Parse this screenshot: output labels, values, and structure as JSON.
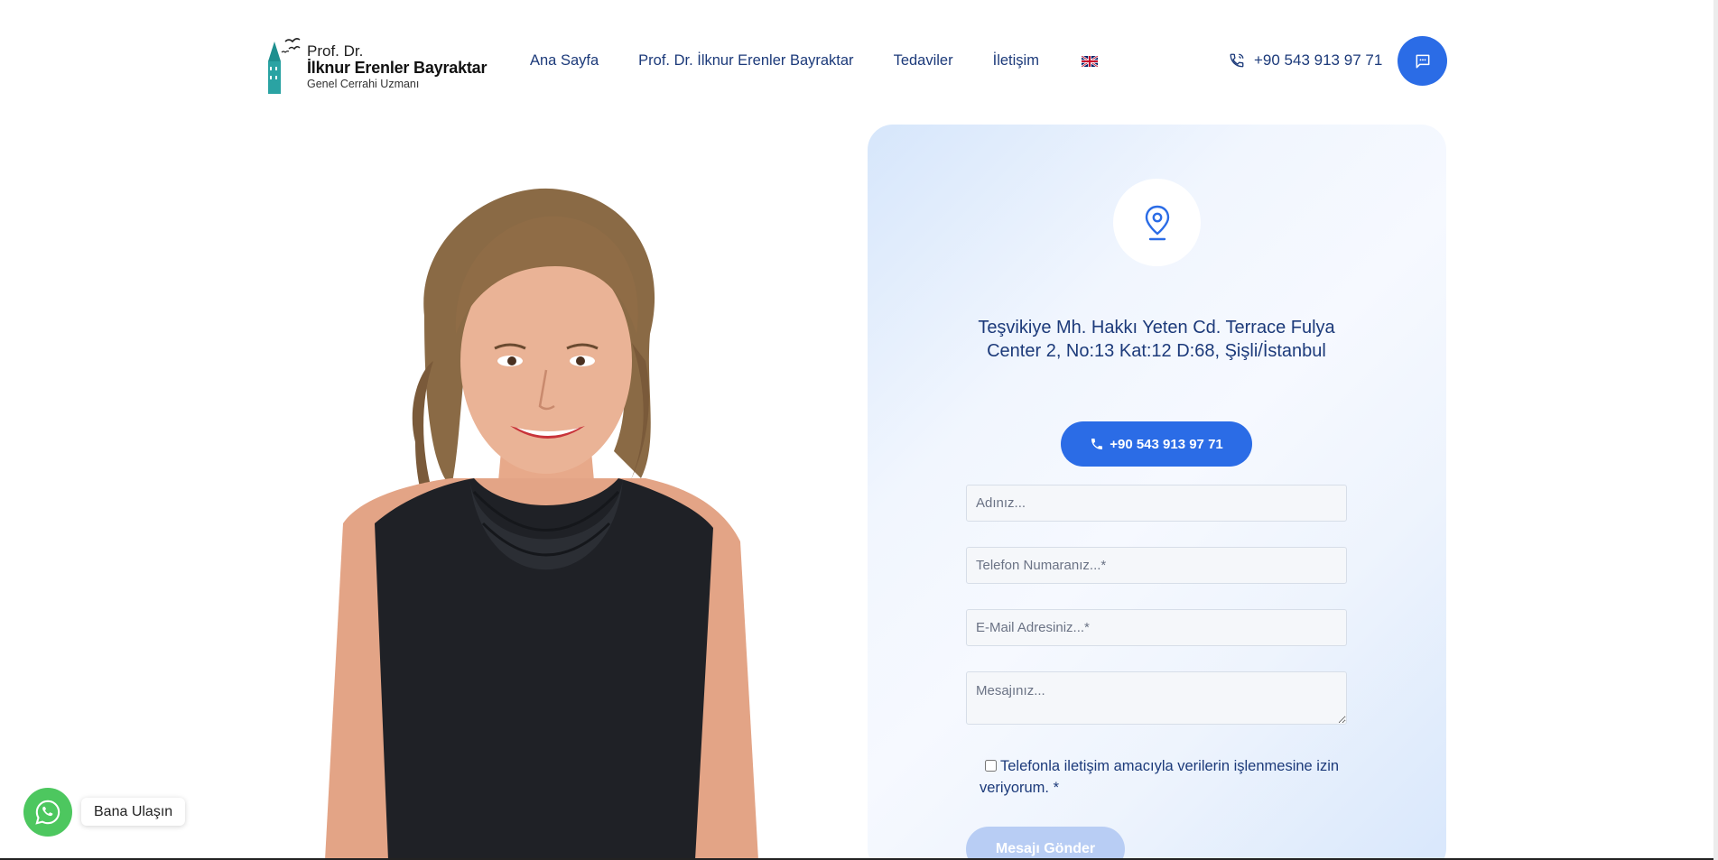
{
  "brand": {
    "line1": "Prof. Dr.",
    "line2": "İlknur Erenler Bayraktar",
    "line3": "Genel Cerrahi Uzmanı"
  },
  "nav": {
    "items": [
      "Ana Sayfa",
      "Prof. Dr. İlknur Erenler Bayraktar",
      "Tedaviler",
      "İletişim"
    ],
    "language_icon": "uk-flag-icon"
  },
  "header": {
    "phone": "+90 543 913 97 71",
    "chat_icon": "chat-bubble-icon"
  },
  "contact": {
    "address": "Teşvikiye Mh. Hakkı Yeten Cd. Terrace Fulya Center 2, No:13 Kat:12 D:68, Şişli/İstanbul",
    "phone_button": "+90 543 913 97 71",
    "form": {
      "name_placeholder": "Adınız...",
      "phone_placeholder": "Telefon Numaranız...*",
      "email_placeholder": "E-Mail Adresiniz...*",
      "message_placeholder": "Mesajınız...",
      "consent_text": "Telefonla iletişim amacıyla verilerin işlenmesine izin veriyorum. *",
      "submit_label": "Mesajı Gönder"
    }
  },
  "whatsapp": {
    "label": "Bana Ulaşın"
  },
  "colors": {
    "accent": "#2b6ce6",
    "nav_text": "#1c3a7a",
    "whatsapp": "#4dc75f",
    "submit_disabled": "#b8cdf4"
  }
}
